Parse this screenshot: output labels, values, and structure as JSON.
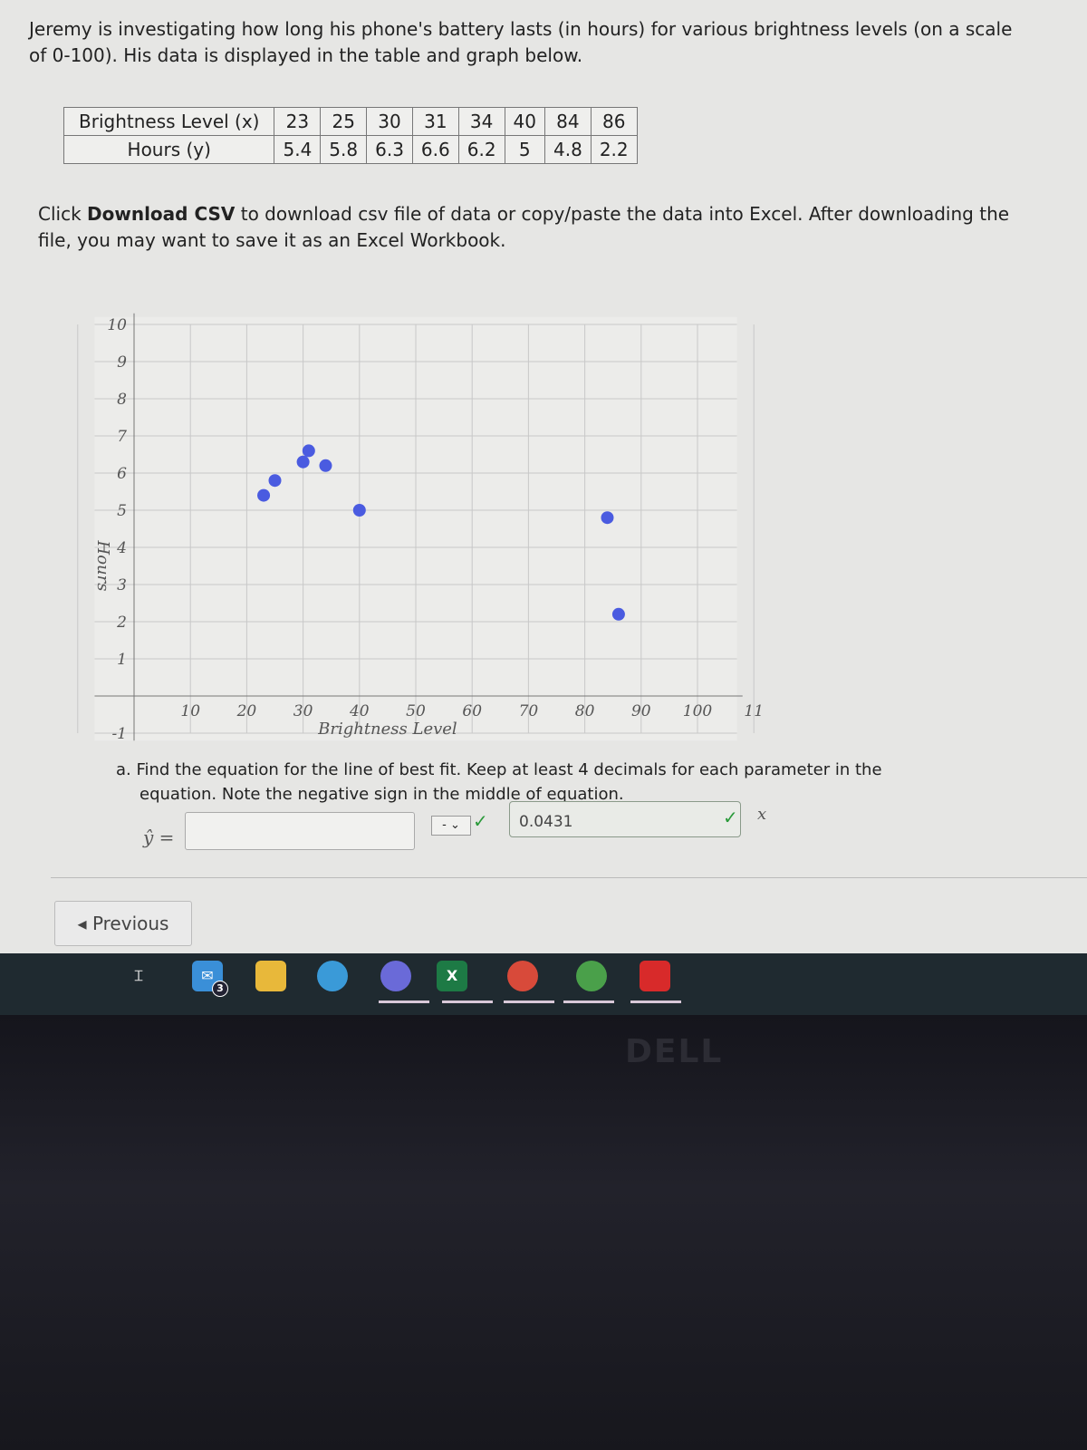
{
  "intro": "Jeremy is investigating how long his phone's battery lasts (in hours) for various brightness levels (on a scale of 0-100). His data is displayed in the table and graph below.",
  "table": {
    "row_headers": [
      "Brightness Level (x)",
      "Hours (y)"
    ],
    "x": [
      "23",
      "25",
      "30",
      "31",
      "34",
      "40",
      "84",
      "86"
    ],
    "y": [
      "5.4",
      "5.8",
      "6.3",
      "6.6",
      "6.2",
      "5",
      "4.8",
      "2.2"
    ]
  },
  "instructions": {
    "bold": "Download CSV",
    "before": "Click ",
    "after": " to download csv file of data or copy/paste the data into Excel. After downloading the file, you may want to save it as an Excel Workbook."
  },
  "chart_data": {
    "type": "scatter",
    "x": [
      23,
      25,
      30,
      31,
      34,
      40,
      84,
      86
    ],
    "y": [
      5.4,
      5.8,
      6.3,
      6.6,
      6.2,
      5,
      4.8,
      2.2
    ],
    "xlabel": "Brightness Level",
    "ylabel": "Hours",
    "xticks": [
      "10",
      "20",
      "30",
      "40",
      "50",
      "60",
      "70",
      "80",
      "90",
      "100",
      "11"
    ],
    "yticks": [
      "10",
      "9",
      "8",
      "7",
      "6",
      "5",
      "4",
      "3",
      "2",
      "1",
      "-1"
    ],
    "point_color": "#4a5be0",
    "grid": true
  },
  "question": {
    "line1": "a. Find the equation for the line of best fit. Keep at least 4 decimals for each parameter in the",
    "line2": "equation. Note the negative sign in the middle of equation.",
    "yhat": "ŷ =",
    "intercept_value": "",
    "sign_value": "-",
    "slope_value": "0.0431",
    "variable": "x"
  },
  "nav": {
    "previous": "Previous"
  },
  "taskbar": {
    "mail_badge": "3",
    "excel_letter": "X"
  },
  "brand": "DELL"
}
